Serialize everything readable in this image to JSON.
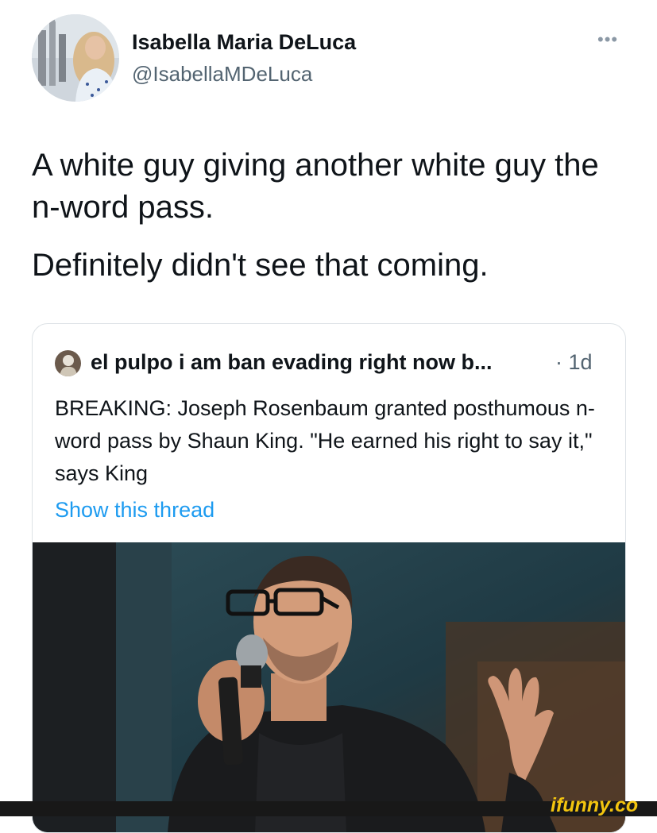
{
  "tweet": {
    "display_name": "Isabella Maria DeLuca",
    "handle": "@IsabellaMDeLuca",
    "more_icon": "more-horizontal-icon",
    "text_line_1": "A white guy giving another white guy the n-word pass.",
    "text_line_2": "Definitely didn't see that coming."
  },
  "quote": {
    "display_name": "el pulpo i am ban evading right now b...",
    "time": "· 1d",
    "text": "BREAKING: Joseph Rosenbaum granted posthumous n-word pass by Shaun King. \"He earned his right to say it,\" says King",
    "show_thread": "Show this thread"
  },
  "watermark": {
    "text": "ifunny.co"
  },
  "colors": {
    "text": "#0f1419",
    "secondary": "#536471",
    "link": "#1d9bf0",
    "border": "#dde2e6",
    "watermark": "#f2c40f"
  }
}
